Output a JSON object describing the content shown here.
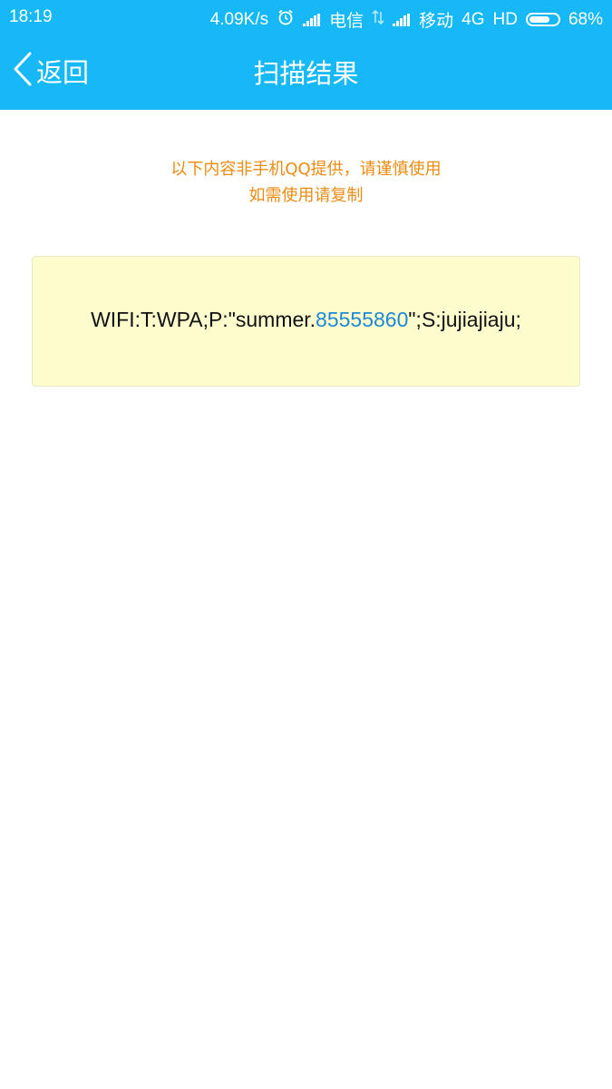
{
  "status_bar": {
    "time": "18:19",
    "net_speed": "4.09K/s",
    "carrier1": "电信",
    "carrier2": "移动",
    "network": "4G",
    "hd": "HD",
    "battery": "68%"
  },
  "nav": {
    "back_label": "返回",
    "title": "扫描结果"
  },
  "notice": {
    "line1": "以下内容非手机QQ提供，请谨慎使用",
    "line2": "如需使用请复制"
  },
  "result": {
    "text_before": "WIFI:T:WPA;P:\"summer.",
    "number_link": "85555860",
    "text_after": "\";S:jujiajiaju;"
  },
  "colors": {
    "header_bg": "#16b9f6",
    "notice": "#ec8b12",
    "result_bg": "#fdfccd",
    "link": "#1e88d6"
  },
  "icons": [
    "alarm-icon",
    "signal-icon",
    "data-transfer-icon",
    "battery-icon",
    "back-chevron-icon"
  ]
}
